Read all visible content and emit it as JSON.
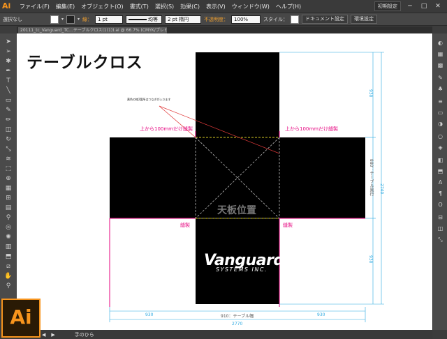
{
  "app": {
    "logo": "Ai"
  },
  "menubar": {
    "items": [
      "ファイル(F)",
      "編集(E)",
      "オブジェクト(O)",
      "書式(T)",
      "選択(S)",
      "効果(C)",
      "表示(V)",
      "ウィンドウ(W)",
      "ヘルプ(H)"
    ],
    "workspace": "初期設定",
    "window_buttons": [
      "─",
      "□",
      "✕"
    ]
  },
  "options_bar": {
    "selection": "選択なし",
    "stroke_label": "線：",
    "stroke_value": "1 pt",
    "profile": "均等",
    "brush": "2 pt 楕円",
    "opacity_label": "不透明度：",
    "opacity_value": "100%",
    "style_label": "スタイル：",
    "doc_settings": "ドキュメント設定",
    "preferences": "環境設定"
  },
  "document_tab": {
    "title": "20111_tc_Vanguard_TC…テーブルクロス(1(1)).ai @ 66.7% (CMYK/プレビュー)"
  },
  "status": {
    "tool": "手のひら"
  },
  "artwork": {
    "title": "テーブルクロス",
    "note": "黄色の線2箇所はつなぎが入ります",
    "sew_top_left": "上から100mmだけ縫製",
    "sew_top_right": "上から100mmだけ縫製",
    "sew_left": "縫製",
    "sew_right": "縫製",
    "center_label": "天板位置",
    "logo_main": "Vanguard",
    "logo_sub": "SYSTEMS INC.",
    "dim_top": "930",
    "dim_middle": "880：テーブル奥行",
    "dim_bottom": "930",
    "dim_total_height": "2740",
    "dim_left": "930",
    "dim_center": "910：テーブル幅",
    "dim_right": "930",
    "dim_total_width": "2770"
  },
  "colors": {
    "accent": "#f7941d",
    "pink": "#e6007e",
    "dimension": "#29a8e0"
  }
}
